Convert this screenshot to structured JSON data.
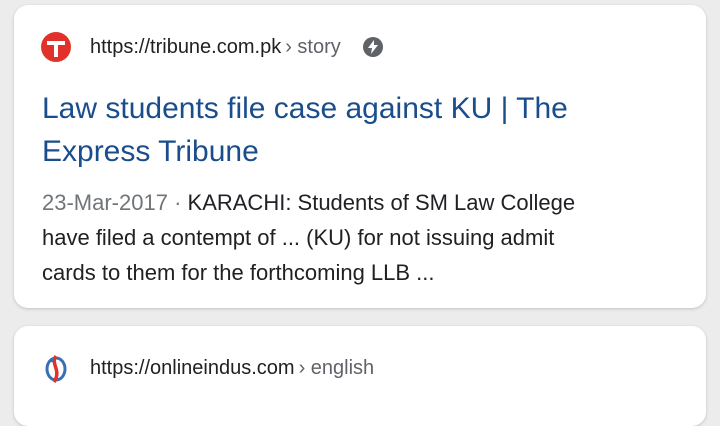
{
  "results": [
    {
      "favicon": "tribune-logo-icon",
      "url_host": "https://tribune.com.pk",
      "url_path": "› story",
      "amp_icon": "amp-bolt-icon",
      "title_line1": "Law students file case against KU | The",
      "title_line2": "Express Tribune",
      "date": "23-Mar-2017",
      "separator": " · ",
      "snippet_line1": "KARACHI: Students of SM Law College",
      "snippet_line2": "have filed a contempt of ... (KU) for not issuing admit",
      "snippet_line3": "cards to them for the forthcoming LLB ..."
    },
    {
      "favicon": "onlineindus-logo-icon",
      "url_host": "https://onlineindus.com",
      "url_path": "› english"
    }
  ],
  "colors": {
    "title_link": "#1a4d8c",
    "text": "#202124",
    "secondary": "#5f6368",
    "tribune_red": "#e0322b"
  }
}
